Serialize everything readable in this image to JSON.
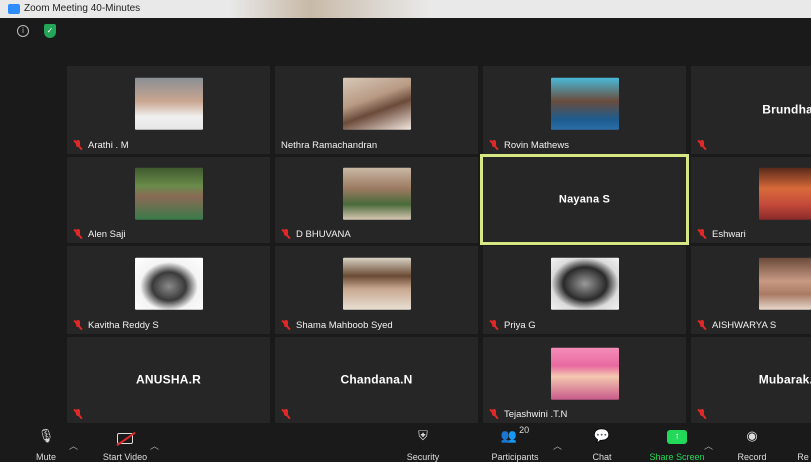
{
  "window": {
    "title": "Zoom Meeting 40-Minutes"
  },
  "colors": {
    "mic_off": "#e02828",
    "active_speaker": "#d6e784",
    "share": "#23d959",
    "shield": "#23a55a"
  },
  "participants": [
    {
      "name": "Arathi . M",
      "muted": true,
      "has_photo": true
    },
    {
      "name": "Nethra Ramachandran",
      "muted": false,
      "has_photo": true
    },
    {
      "name": "Rovin Mathews",
      "muted": true,
      "has_photo": true
    },
    {
      "name": "",
      "display": "Brundha",
      "muted": true,
      "has_photo": false
    },
    {
      "name": "Alen Saji",
      "muted": true,
      "has_photo": true
    },
    {
      "name": "D BHUVANA",
      "muted": true,
      "has_photo": true
    },
    {
      "name": "",
      "display": "Nayana S",
      "muted": false,
      "has_photo": false,
      "active_speaker": true
    },
    {
      "name": "Eshwari",
      "muted": true,
      "has_photo": true
    },
    {
      "name": "Kavitha Reddy S",
      "muted": true,
      "has_photo": true
    },
    {
      "name": "Shama Mahboob Syed",
      "muted": true,
      "has_photo": true
    },
    {
      "name": "Priya G",
      "muted": true,
      "has_photo": true
    },
    {
      "name": "AISHWARYA S",
      "muted": true,
      "has_photo": true
    },
    {
      "name": "",
      "display": "ANUSHA.R",
      "muted": true,
      "has_photo": false
    },
    {
      "name": "",
      "display": "Chandana.N",
      "muted": true,
      "has_photo": false
    },
    {
      "name": "Tejashwini .T.N",
      "muted": true,
      "has_photo": true
    },
    {
      "name": "",
      "display": "Mubarak.",
      "muted": true,
      "has_photo": false
    }
  ],
  "toolbar": {
    "mute": "Mute",
    "start_video": "Start Video",
    "security": "Security",
    "participants": "Participants",
    "participants_count": "20",
    "chat": "Chat",
    "share_screen": "Share Screen",
    "record": "Record",
    "reactions": "Re"
  }
}
